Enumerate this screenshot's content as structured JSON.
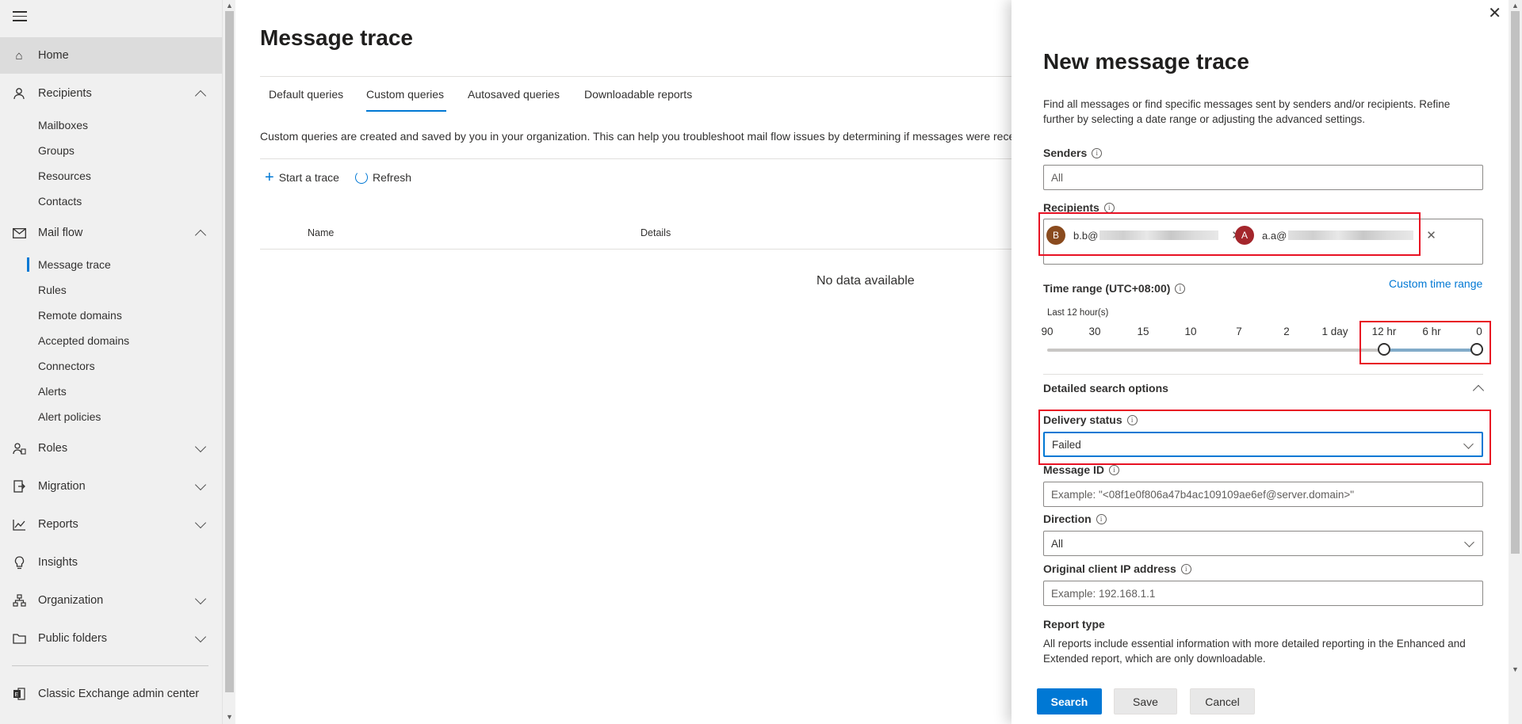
{
  "nav": {
    "items": [
      {
        "label": "Home",
        "icon": "home-icon"
      },
      {
        "label": "Recipients",
        "icon": "person-icon"
      },
      {
        "label": "Mail flow",
        "icon": "mail-icon"
      },
      {
        "label": "Roles",
        "icon": "roles-icon"
      },
      {
        "label": "Migration",
        "icon": "migration-icon"
      },
      {
        "label": "Reports",
        "icon": "chart-icon"
      },
      {
        "label": "Insights",
        "icon": "lightbulb-icon"
      },
      {
        "label": "Organization",
        "icon": "org-icon"
      },
      {
        "label": "Public folders",
        "icon": "folder-icon"
      },
      {
        "label": "Classic Exchange admin center",
        "icon": "exchange-icon"
      }
    ],
    "recipients_sub": [
      "Mailboxes",
      "Groups",
      "Resources",
      "Contacts"
    ],
    "mailflow_sub": [
      "Message trace",
      "Rules",
      "Remote domains",
      "Accepted domains",
      "Connectors",
      "Alerts",
      "Alert policies"
    ]
  },
  "main": {
    "title": "Message trace",
    "tabs": [
      "Default queries",
      "Custom queries",
      "Autosaved queries",
      "Downloadable reports"
    ],
    "description": "Custom queries are created and saved by you in your organization. This can help you troubleshoot mail flow issues by determining if messages were recei",
    "start_trace": "Start a trace",
    "refresh": "Refresh",
    "col_name": "Name",
    "col_details": "Details",
    "no_data": "No data available"
  },
  "panel": {
    "title": "New message trace",
    "description": "Find all messages or find specific messages sent by senders and/or recipients. Refine further by selecting a date range or adjusting the advanced settings.",
    "senders_label": "Senders",
    "senders_placeholder": "All",
    "recipients_label": "Recipients",
    "chip1_initial": "B",
    "chip1_text": "b.b@",
    "chip2_initial": "A",
    "chip2_text": "a.a@",
    "time_range_label": "Time range (UTC+08:00)",
    "custom_time_range": "Custom time range",
    "selected_range": "Last 12 hour(s)",
    "ticks": [
      "90",
      "30",
      "15",
      "10",
      "7",
      "2",
      "1 day",
      "12 hr",
      "6 hr",
      "0"
    ],
    "detailed_label": "Detailed search options",
    "delivery_status_label": "Delivery status",
    "delivery_status_value": "Failed",
    "message_id_label": "Message ID",
    "message_id_placeholder": "Example: \"<08f1e0f806a47b4ac109109ae6ef@server.domain>\"",
    "direction_label": "Direction",
    "direction_value": "All",
    "client_ip_label": "Original client IP address",
    "client_ip_placeholder": "Example: 192.168.1.1",
    "report_type_label": "Report type",
    "report_type_desc": "All reports include essential information with more detailed reporting in the Enhanced and Extended report, which are only downloadable.",
    "search_button": "Search",
    "save_button": "Save",
    "cancel_button": "Cancel"
  },
  "colors": {
    "accent": "#0078d4",
    "highlight": "#e81123",
    "chip_b": "#8a4b1e",
    "chip_a": "#a4262c"
  }
}
